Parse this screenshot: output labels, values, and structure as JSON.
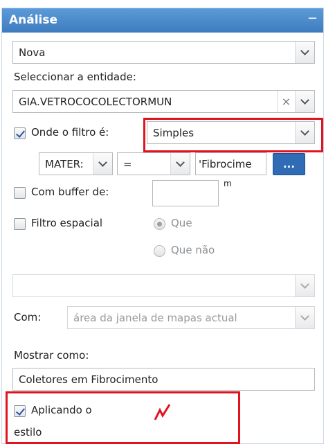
{
  "panel": {
    "title": "Análise",
    "collapse_symbol": "−"
  },
  "mode_select": {
    "value": "Nova"
  },
  "entity": {
    "label": "Seleccionar a entidade:",
    "value": "GIA.VETROCOCOLECTORMUN",
    "clear_symbol": "×"
  },
  "filter": {
    "checkbox_label": "Onde o filtro é:",
    "checked": true,
    "type_value": "Simples",
    "field_value": "MATER:",
    "operator_value": "=",
    "value_text": "'Fibrocime",
    "dots_label": "..."
  },
  "buffer": {
    "label": "Com buffer de:",
    "checked": false,
    "value": "",
    "unit": "m"
  },
  "spatial": {
    "label": "Filtro espacial",
    "checked": false,
    "options": [
      {
        "label": "Que",
        "selected": true
      },
      {
        "label": "Que não",
        "selected": false
      }
    ],
    "relation_value": ""
  },
  "with": {
    "label": "Com:",
    "value": "área da janela de mapas actual"
  },
  "show_as": {
    "label": "Mostrar como:",
    "value": "Coletores em Fibrocimento"
  },
  "apply_style": {
    "line1": "Aplicando o",
    "line2": "estilo",
    "checked": true
  },
  "colors": {
    "header": "#4a88cc",
    "highlight": "#e0131f",
    "accent_button": "#2f6cb5"
  }
}
